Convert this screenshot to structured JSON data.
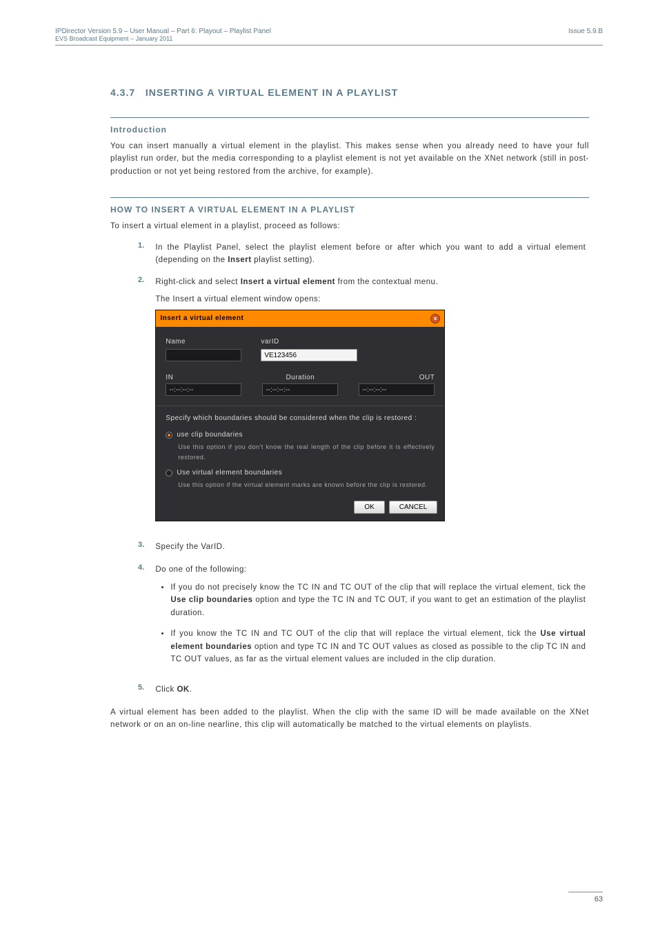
{
  "header": {
    "leftLine1": "IPDirector Version 5.9 – User Manual – Part 6: Playout – Playlist Panel",
    "leftLine2": "EVS Broadcast Equipment – January 2011",
    "right": "Issue 5.9.B"
  },
  "sectionNumber": "4.3.7",
  "sectionTitle": "INSERTING A VIRTUAL ELEMENT IN A PLAYLIST",
  "introNumber": "Introduction",
  "introPara": "You can insert manually a virtual element in the playlist. This makes sense when you already need to have your full playlist run order, but the media corresponding to a playlist element is not yet available on the XNet network (still in post-production or not yet being restored from the archive, for example).",
  "howtoTitle": "HOW TO INSERT A VIRTUAL ELEMENT IN A PLAYLIST",
  "howtoLead": "To insert a virtual element in a playlist, proceed as follows:",
  "steps": {
    "s1_num": "1.",
    "s1_a": "In the Playlist Panel, select the playlist element before or after which you want to add a virtual element (depending on the ",
    "s1_bold": "Insert",
    "s1_b": " playlist setting).",
    "s2_num": "2.",
    "s2_a": "Right-click and select ",
    "s2_bold": "Insert a virtual element",
    "s2_b": " from the contextual menu.",
    "s2_c": "The Insert a virtual element window opens:",
    "s3_num": "3.",
    "s3": "Specify the VarID.",
    "s4_num": "4.",
    "s4": "Do one of the following:",
    "s4_b1_a": "If you do not precisely know the TC IN and TC OUT of the clip that will replace the virtual element, tick the ",
    "s4_b1_bold": "Use clip boundaries",
    "s4_b1_b": " option and type the TC IN and TC OUT, if you want to get an estimation of the playlist duration.",
    "s4_b2_a": "If you know the TC IN and TC OUT of the clip that will replace the virtual element, tick the ",
    "s4_b2_bold": "Use virtual element boundaries",
    "s4_b2_b": " option and type TC IN and TC OUT values as closed as possible to the clip TC IN and TC OUT values, as far as the virtual element values are included in the clip duration.",
    "s5_num": "5.",
    "s5_a": "Click ",
    "s5_bold": "OK",
    "s5_b": "."
  },
  "closingPara": "A virtual element has been added to the playlist. When the clip with the same ID will be made available on the XNet network or on an on-line nearline, this clip will automatically be matched to the virtual elements on playlists.",
  "dialog": {
    "title": "Insert a virtual element",
    "nameLabel": "Name",
    "nameValue": "",
    "varidLabel": "varID",
    "varidValue": "VE123456",
    "inLabel": "IN",
    "inValue": "--:--:--:--",
    "durationLabel": "Duration",
    "durationValue": "--:--:--:--",
    "outLabel": "OUT",
    "outValue": "--:--:--:--",
    "specLine": "Specify which boundaries should be considered when the clip is restored :",
    "opt1": "use clip boundaries",
    "opt1Note": "Use this option if you don't know the real length of the clip before it is effectively restored.",
    "opt2": "Use virtual element boundaries",
    "opt2Note": "Use this option if the virtual element marks are known before the clip is restored.",
    "ok": "OK",
    "cancel": "CANCEL"
  },
  "pageNumber": "63"
}
